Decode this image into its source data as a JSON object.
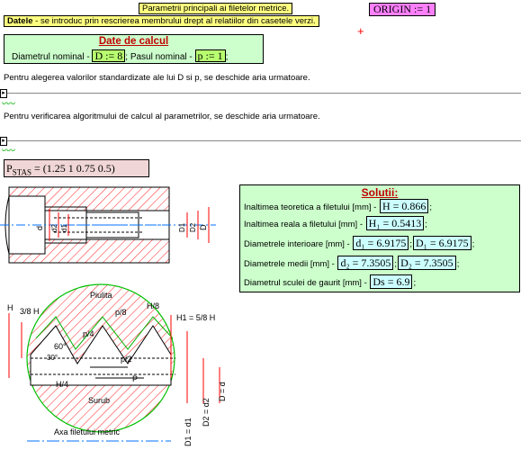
{
  "header": {
    "title": "Parametrii principali ai filetelor metrice.",
    "origin": "ORIGIN := 1"
  },
  "datele": {
    "bold": "Datele",
    "text": " - se introduc prin rescrierea membrului drept al relatiilor din casetele verzi."
  },
  "calc": {
    "title": "Date de calcul",
    "diam_label": "Diametrul nominal - ",
    "diam_value": "D := 8",
    "sep": "; Pasul nominal - ",
    "pas_value": "p := 1",
    "end": ";"
  },
  "notes": {
    "alegere": "Pentru alegerea valorilor standardizate ale lui D si p, se deschide aria urmatoare.",
    "verificare": "Pentru verificarea algoritmului de calcul al parametrilor, se deschide aria urmatoare."
  },
  "pstas": {
    "name": "P",
    "sub": "STAS",
    "value": "= (1.25   1   0.75   0.5)"
  },
  "solutii": {
    "title": "Solutii:",
    "rows": [
      {
        "label": "Inaltimea teoretica a filetului [mm] - ",
        "results": [
          "H = 0.866"
        ],
        "end": ";"
      },
      {
        "label": "Inaltimea reala a filetului [mm] - ",
        "results": [
          "H₁ = 0.5413"
        ],
        "end": ";"
      },
      {
        "label": "Diametrele interioare [mm] - ",
        "results": [
          "d₁ = 6.9175",
          "D₁ = 6.9175"
        ],
        "end": ";"
      },
      {
        "label": "Diametrele medii [mm] - ",
        "results": [
          "d₂ = 7.3505",
          "D₂ = 7.3505"
        ],
        "end": ";"
      },
      {
        "label": "Diametrul sculei de gaurit [mm] - ",
        "results": [
          "Ds = 6.9"
        ],
        "end": ";"
      }
    ]
  },
  "drawing": {
    "labels": {
      "piulita": "Piulita",
      "surub": "Surub",
      "axa": "Axa filetului metric",
      "h38": "3/8 H",
      "h_left": "H",
      "h8": "H/8",
      "p8": "p/8",
      "h1": "H1 = 5/8 H",
      "p4": "p/4",
      "p2": "p/2",
      "p": "P",
      "h4": "H/4",
      "a60": "60°",
      "a30": "30°",
      "d1v": "D1 = d1",
      "d2v": "D2 = d2",
      "dv": "D = d",
      "d": "d",
      "d2": "d2",
      "d1": "d1",
      "D1": "D1",
      "D2": "D2",
      "D": "D"
    }
  }
}
